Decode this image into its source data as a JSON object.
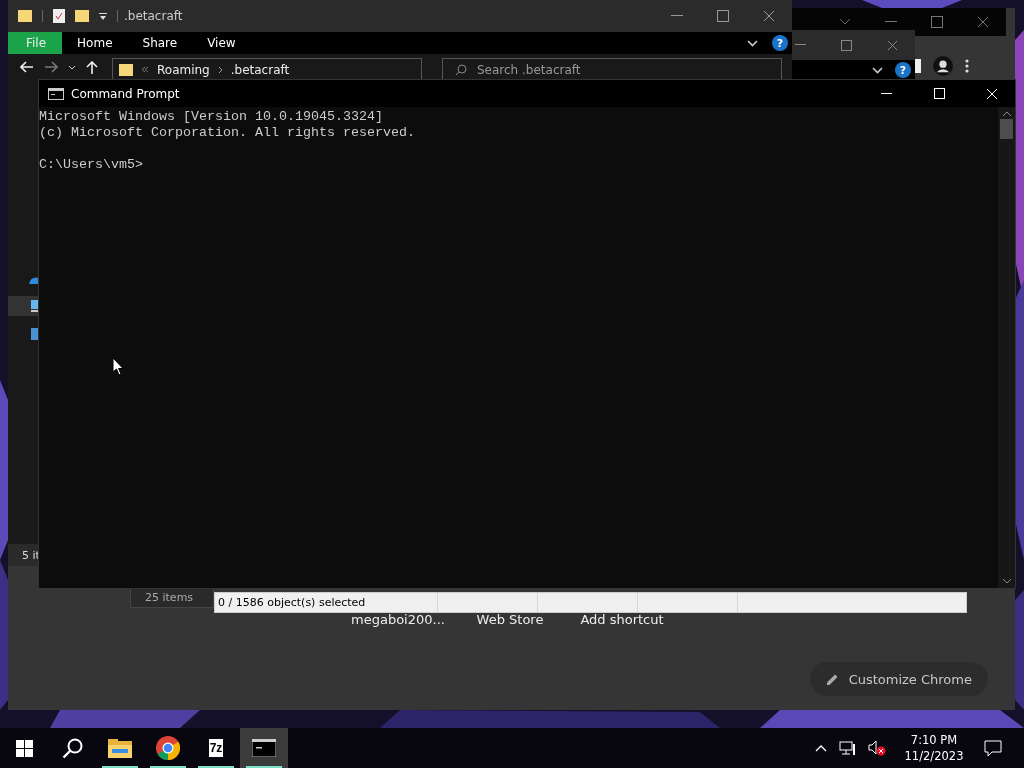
{
  "chrome_window": {
    "shortcuts": [
      {
        "label": "megaboi200..."
      },
      {
        "label": "Web Store"
      },
      {
        "label": "Add shortcut"
      }
    ],
    "customize_button": "Customize Chrome"
  },
  "second_window": {
    "help": "?"
  },
  "explorer_window": {
    "title": ".betacraft",
    "ribbon_tabs": [
      {
        "label": "File",
        "kind": "file-menu"
      },
      {
        "label": "Home",
        "kind": "tab"
      },
      {
        "label": "Share",
        "kind": "tab"
      },
      {
        "label": "View",
        "kind": "tab"
      }
    ],
    "help": "?",
    "breadcrumb": [
      "Roaming",
      ".betacraft"
    ],
    "search": {
      "placeholder": "Search .betacraft"
    },
    "status": "5 it"
  },
  "back_window": {
    "status": "25 items"
  },
  "archive_window": {
    "status": "0 / 1586 object(s) selected"
  },
  "command_prompt": {
    "title": "Command Prompt",
    "lines": [
      "Microsoft Windows [Version 10.0.19045.3324]",
      "(c) Microsoft Corporation. All rights reserved."
    ],
    "prompt": "C:\\Users\\vm5>"
  },
  "taskbar": {
    "apps": [
      {
        "kind": "start",
        "running": false,
        "selected": false
      },
      {
        "kind": "search",
        "running": false,
        "selected": false
      },
      {
        "kind": "folder",
        "running": true,
        "selected": false
      },
      {
        "kind": "browser",
        "running": true,
        "selected": false
      },
      {
        "kind": "archiver",
        "label": "7z",
        "running": true,
        "selected": false
      },
      {
        "kind": "terminal",
        "running": true,
        "selected": true
      }
    ],
    "time": "7:10 PM",
    "date": "11/2/2023"
  }
}
